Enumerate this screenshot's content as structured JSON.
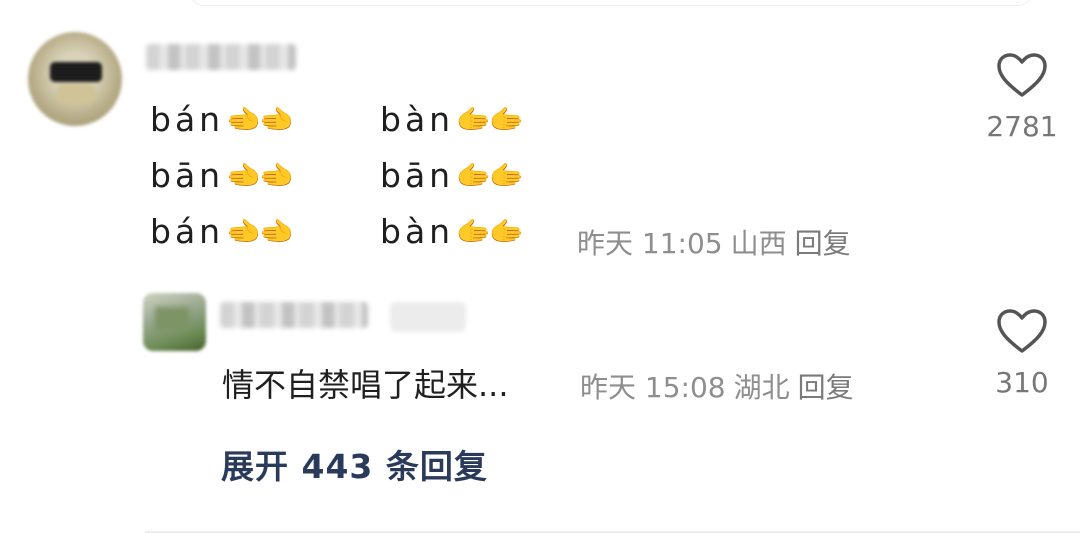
{
  "comment": {
    "lines": [
      {
        "a_text": "bán",
        "a_hands": "🫲🫲",
        "b_text": "bàn",
        "b_hands": "🫱🫱"
      },
      {
        "a_text": "bān",
        "a_hands": "🫲🫲",
        "b_text": "bān",
        "b_hands": "🫱🫱"
      },
      {
        "a_text": "bán",
        "a_hands": "🫲🫲",
        "b_text": "bàn",
        "b_hands": "🫱🫱"
      }
    ],
    "time": "昨天 11:05",
    "location": "山西",
    "reply_label": "回复",
    "likes": "2781"
  },
  "reply": {
    "text": "情不自禁唱了起来...",
    "time": "昨天 15:08",
    "location": "湖北",
    "reply_label": "回复",
    "likes": "310"
  },
  "expand_label": "展开 443 条回复",
  "icons": {
    "like": "heart-outline-icon"
  }
}
